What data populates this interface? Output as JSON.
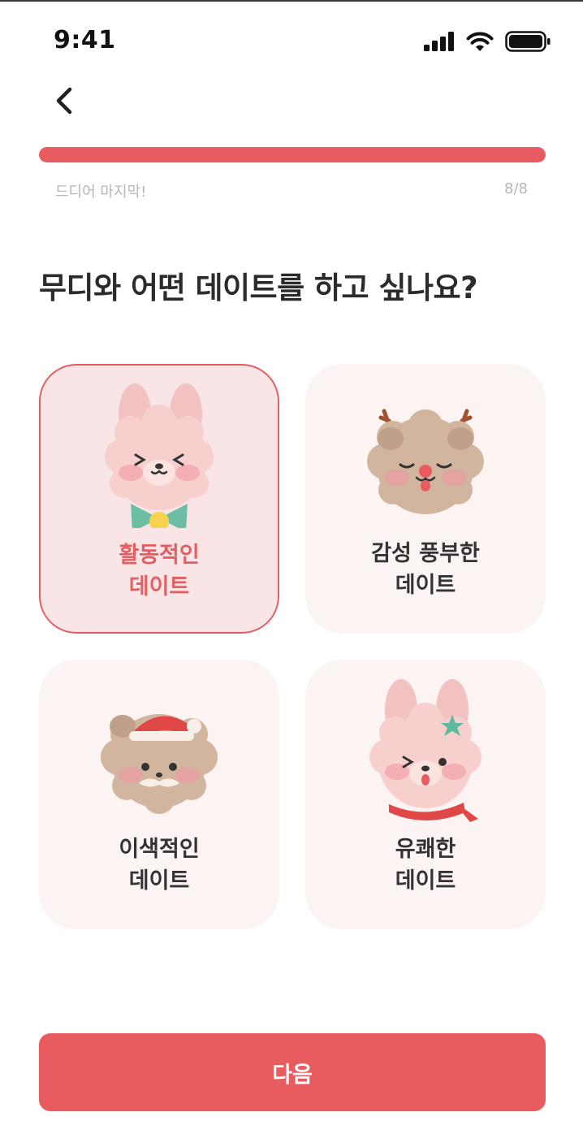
{
  "status_bar": {
    "time": "9:41",
    "icons": [
      "signal-icon",
      "wifi-icon",
      "battery-icon"
    ]
  },
  "nav": {
    "back_icon": "chevron-left-icon"
  },
  "progress": {
    "label": "드디어 마지막!",
    "count": "8/8",
    "fraction": 1.0,
    "color": "#e85c60",
    "track_color": "#eeeeee"
  },
  "question": "무디와 어떤 데이트를 하고 싶나요?",
  "options": [
    {
      "line1": "활동적인",
      "line2": "데이트",
      "selected": true,
      "character": "pink-bunny-with-bow"
    },
    {
      "line1": "감성 풍부한",
      "line2": "데이트",
      "selected": false,
      "character": "reindeer-puppy"
    },
    {
      "line1": "이색적인",
      "line2": "데이트",
      "selected": false,
      "character": "santa-hat-puppy"
    },
    {
      "line1": "유쾌한",
      "line2": "데이트",
      "selected": false,
      "character": "pink-bunny-with-scarf"
    }
  ],
  "next_button": {
    "label": "다음",
    "color": "#e85c60"
  },
  "colors": {
    "accent": "#e85c60",
    "selected_card_bg": "#fae5e6",
    "card_bg": "#fcf3f3"
  }
}
